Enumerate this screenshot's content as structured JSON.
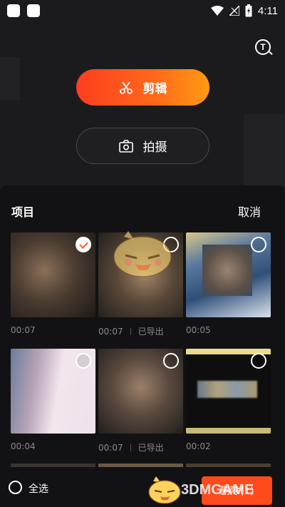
{
  "status_bar": {
    "time": "4:11"
  },
  "actions": {
    "edit_label": "剪辑",
    "shoot_label": "拍摄"
  },
  "sheet": {
    "title": "项目",
    "cancel_label": "取消",
    "items": [
      {
        "duration": "00:07",
        "status": "",
        "selected": true
      },
      {
        "duration": "00:07",
        "status": "已导出",
        "selected": false
      },
      {
        "duration": "00:05",
        "status": "",
        "selected": false
      },
      {
        "duration": "00:04",
        "status": "",
        "selected": false
      },
      {
        "duration": "00:07",
        "status": "已导出",
        "selected": false
      },
      {
        "duration": "00:02",
        "status": "",
        "selected": false
      }
    ]
  },
  "bottom_bar": {
    "select_all_label": "全选",
    "delete_label": "删除(1)"
  },
  "watermark": {
    "text": "3DMGAME"
  },
  "colors": {
    "accent": "#ff4a1c",
    "background": "#1b1b1d",
    "sheet": "#121214"
  },
  "icons": [
    "scissors-icon",
    "camera-icon",
    "text-search-icon",
    "wifi-icon",
    "signal-icon",
    "battery-icon",
    "check-icon"
  ]
}
